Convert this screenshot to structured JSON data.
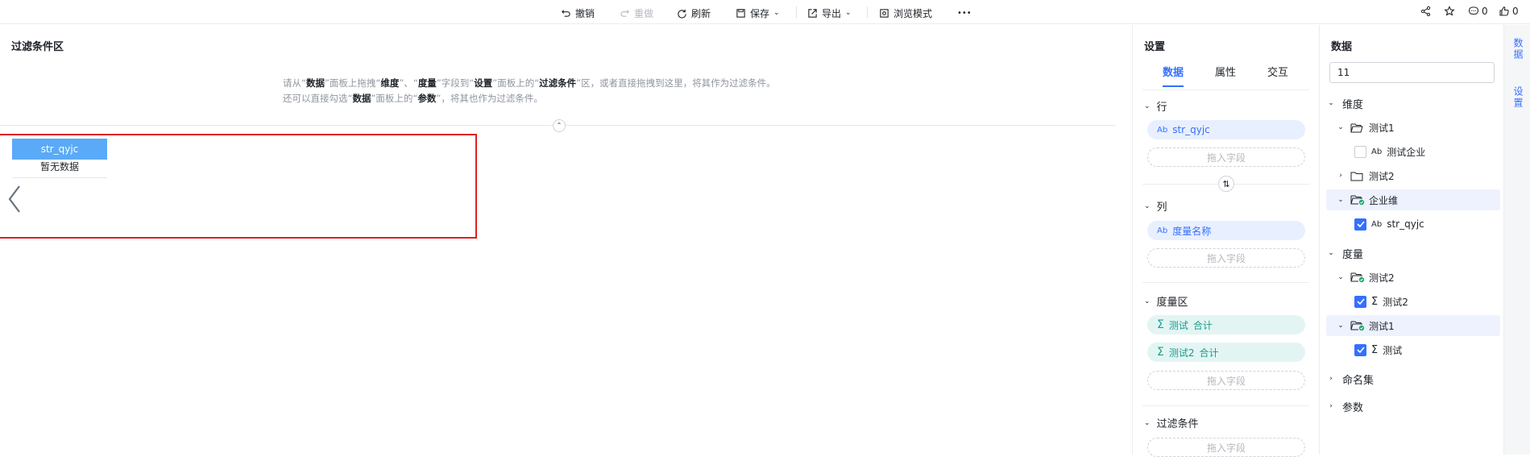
{
  "toolbar": {
    "undo": "撤销",
    "redo": "重做",
    "refresh": "刷新",
    "save": "保存",
    "export": "导出",
    "browse_mode": "浏览模式",
    "more": "•••",
    "comment_count": "0",
    "like_count": "0"
  },
  "canvas": {
    "title": "过滤条件区",
    "hint_line1": {
      "a": "请从“",
      "b": "数据",
      "c": "”面板上拖拽“",
      "d": "维度",
      "e": "”、“",
      "f": "度量",
      "g": "”字段到“",
      "h": "设置",
      "i": "”面板上的“",
      "j": "过滤条件",
      "k": "”区，或者直接拖拽到这里，将其作为过滤条件。"
    },
    "hint_line2": {
      "a": "还可以直接勾选“",
      "b": "数据",
      "c": "”面板上的“",
      "d": "参数",
      "e": "”，将其也作为过滤条件。"
    },
    "filter_widget": {
      "header": "str_qyjc",
      "empty_text": "暂无数据"
    }
  },
  "settings": {
    "title": "设置",
    "tabs": [
      "数据",
      "属性",
      "交互"
    ],
    "active_tab": "数据",
    "row_label": "行",
    "row_field": "str_qyjc",
    "col_label": "列",
    "col_field": "度量名称",
    "measure_label": "度量区",
    "measures": [
      {
        "name": "测试",
        "agg": "合计"
      },
      {
        "name": "测试2",
        "agg": "合计"
      }
    ],
    "filter_label": "过滤条件",
    "drop_placeholder": "拖入字段",
    "dim_icon": "Ab",
    "measure_icon": "Σ"
  },
  "data_panel": {
    "title": "数据",
    "search_value": "11",
    "dimension_label": "维度",
    "measure_label": "度量",
    "named_set_label": "命名集",
    "param_label": "参数",
    "dim_items": [
      {
        "label": "测试1",
        "type": "folder",
        "expanded": true
      },
      {
        "label": "测试企业",
        "type": "field",
        "checked": false
      },
      {
        "label": "测试2",
        "type": "folder",
        "expanded": false
      },
      {
        "label": "企业维",
        "type": "folder-used",
        "expanded": true
      },
      {
        "label": "str_qyjc",
        "type": "field",
        "checked": true
      }
    ],
    "measure_items": [
      {
        "label": "测试2",
        "type": "folder-used",
        "expanded": true
      },
      {
        "label": "测试2",
        "type": "measure",
        "checked": true
      },
      {
        "label": "测试1",
        "type": "folder-used",
        "expanded": true
      },
      {
        "label": "测试",
        "type": "measure",
        "checked": true
      }
    ]
  },
  "side_strip": {
    "tab_data": "数据",
    "tab_settings": "设置"
  },
  "colors": {
    "accent": "#3370ff",
    "selection_border": "#e02020",
    "filter_header": "#5aaaf7",
    "measure_pill": "#e3f5f3"
  }
}
